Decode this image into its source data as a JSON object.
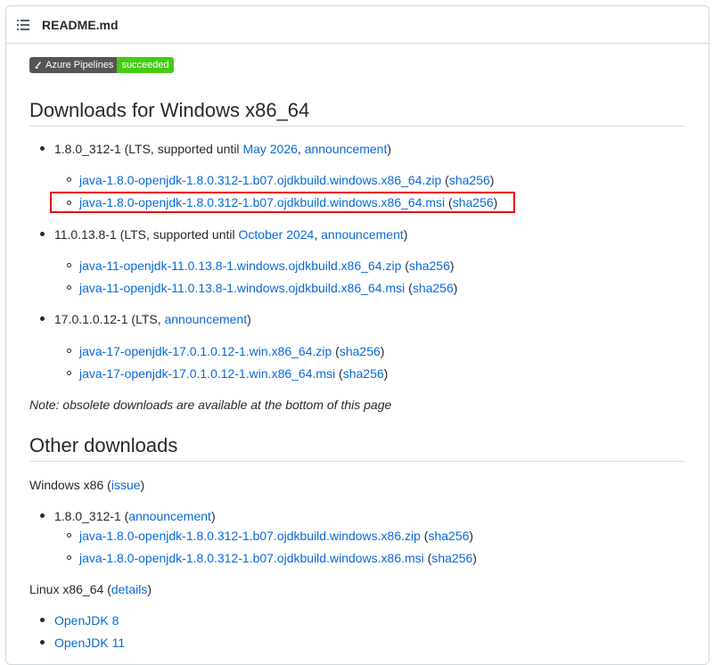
{
  "header": {
    "filename": "README.md",
    "icon": "list-icon"
  },
  "badge": {
    "left_label": "Azure Pipelines",
    "right_label": "succeeded",
    "left_color": "#555555",
    "right_color": "#44cc11"
  },
  "section1": {
    "heading": "Downloads for Windows x86_64",
    "releases": [
      {
        "version": "1.8.0_312-1",
        "pre": "(LTS, supported until ",
        "until_link": "May 2026",
        "sep": ", ",
        "announce_link": "announcement",
        "post": ")",
        "files": [
          {
            "link": "java-1.8.0-openjdk-1.8.0.312-1.b07.ojdkbuild.windows.x86_64.zip",
            "open": " (",
            "sha": "sha256",
            "close": ")"
          },
          {
            "link": "java-1.8.0-openjdk-1.8.0.312-1.b07.ojdkbuild.windows.x86_64.msi",
            "open": " (",
            "sha": "sha256",
            "close": ")"
          }
        ]
      },
      {
        "version": "11.0.13.8-1",
        "pre": "(LTS, supported until ",
        "until_link": "October 2024",
        "sep": ", ",
        "announce_link": "announcement",
        "post": ")",
        "files": [
          {
            "link": "java-11-openjdk-11.0.13.8-1.windows.ojdkbuild.x86_64.zip",
            "open": " (",
            "sha": "sha256",
            "close": ")"
          },
          {
            "link": "java-11-openjdk-11.0.13.8-1.windows.ojdkbuild.x86_64.msi",
            "open": " (",
            "sha": "sha256",
            "close": ")"
          }
        ]
      },
      {
        "version": "17.0.1.0.12-1",
        "pre": "(LTS, ",
        "announce_link": "announcement",
        "post": ")",
        "files": [
          {
            "link": "java-17-openjdk-17.0.1.0.12-1.win.x86_64.zip",
            "open": " (",
            "sha": "sha256",
            "close": ")"
          },
          {
            "link": "java-17-openjdk-17.0.1.0.12-1.win.x86_64.msi",
            "open": " (",
            "sha": "sha256",
            "close": ")"
          }
        ]
      }
    ],
    "note": "Note: obsolete downloads are available at the bottom of this page"
  },
  "section2": {
    "heading": "Other downloads",
    "win86": {
      "label": "Windows x86 ",
      "open": "(",
      "link": "issue",
      "close": ")"
    },
    "win86_release": {
      "version": "1.8.0_312-1",
      "open": " (",
      "announce_link": "announcement",
      "close": ")",
      "files": [
        {
          "link": "java-1.8.0-openjdk-1.8.0.312-1.b07.ojdkbuild.windows.x86.zip",
          "open": " (",
          "sha": "sha256",
          "close": ")"
        },
        {
          "link": "java-1.8.0-openjdk-1.8.0.312-1.b07.ojdkbuild.windows.x86.msi",
          "open": " (",
          "sha": "sha256",
          "close": ")"
        }
      ]
    },
    "linux": {
      "label": "Linux x86_64 ",
      "open": "(",
      "link": "details",
      "close": ")"
    },
    "linux_items": [
      "OpenJDK 8",
      "OpenJDK 11"
    ]
  }
}
